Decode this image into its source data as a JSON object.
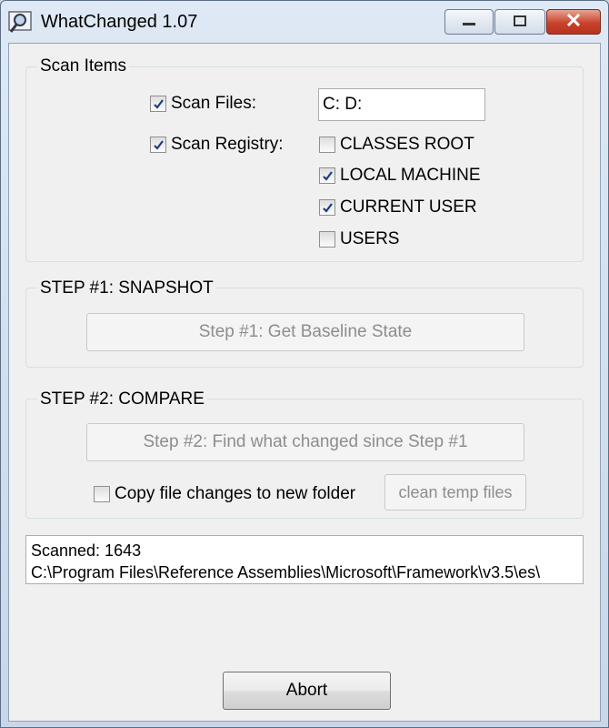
{
  "window": {
    "title": "WhatChanged 1.07",
    "icons": {
      "app": "magnifier-icon",
      "minimize": "minimize-icon",
      "maximize": "maximize-icon",
      "close": "close-icon"
    }
  },
  "scan_items": {
    "label": "Scan Items",
    "scan_files": {
      "label": "Scan Files:",
      "checked": true,
      "value": "C: D:"
    },
    "scan_registry": {
      "label": "Scan Registry:",
      "checked": true
    },
    "registry_options": [
      {
        "label": "CLASSES ROOT",
        "checked": false
      },
      {
        "label": "LOCAL MACHINE",
        "checked": true
      },
      {
        "label": "CURRENT USER",
        "checked": true
      },
      {
        "label": "USERS",
        "checked": false
      }
    ]
  },
  "step1": {
    "label": "STEP #1:  SNAPSHOT",
    "button": "Step #1:  Get Baseline State"
  },
  "step2": {
    "label": "STEP #2:  COMPARE",
    "button": "Step #2:  Find what changed since Step #1",
    "copy_checkbox": {
      "label": "Copy file changes to new folder",
      "checked": false
    },
    "clean_button": "clean temp files"
  },
  "status": {
    "line1": "Scanned: 1643",
    "line2": "C:\\Program Files\\Reference Assemblies\\Microsoft\\Framework\\v3.5\\es\\"
  },
  "abort_button": "Abort"
}
